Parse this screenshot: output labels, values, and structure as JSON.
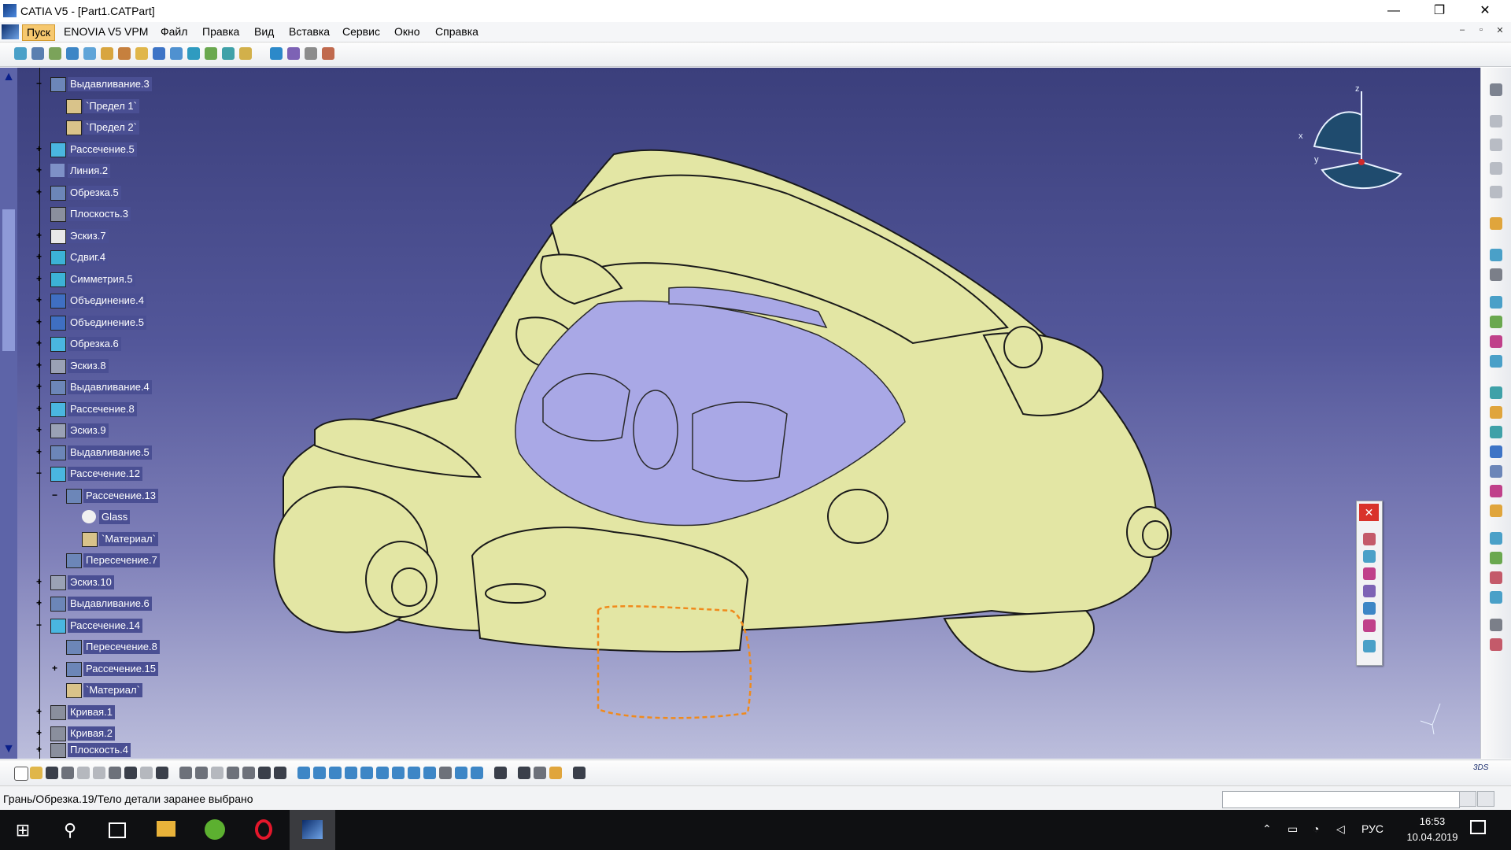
{
  "window": {
    "title": "CATIA V5 - [Part1.CATPart]",
    "minimize": "—",
    "maximize": "❐",
    "close": "✕"
  },
  "menu": {
    "items": [
      "Пуск",
      "ENOVIA V5 VPM",
      "Файл",
      "Правка",
      "Вид",
      "Вставка",
      "Сервис",
      "Окно",
      "Справка"
    ],
    "active_index": 0,
    "mdi_min": "–",
    "mdi_restore": "▫",
    "mdi_close": "✕"
  },
  "tree": {
    "scroll_up": "▲",
    "scroll_down": "▼",
    "nodes": [
      {
        "label": "Выдавливание.3",
        "icon": "pad-icon"
      },
      {
        "label": "`Предел 1`",
        "icon": "limit-icon"
      },
      {
        "label": "`Предел 2`",
        "icon": "limit-icon"
      },
      {
        "label": "Рассечение.5",
        "icon": "split-icon"
      },
      {
        "label": "Линия.2",
        "icon": "line-icon"
      },
      {
        "label": "Обрезка.5",
        "icon": "trim-icon"
      },
      {
        "label": "Плоскость.3",
        "icon": "plane-icon"
      },
      {
        "label": "Эскиз.7",
        "icon": "sketch-icon"
      },
      {
        "label": "Сдвиг.4",
        "icon": "translate-icon"
      },
      {
        "label": "Симметрия.5",
        "icon": "symmetry-icon"
      },
      {
        "label": "Объединение.4",
        "icon": "join-icon"
      },
      {
        "label": "Объединение.5",
        "icon": "join-icon"
      },
      {
        "label": "Обрезка.6",
        "icon": "trim-icon"
      },
      {
        "label": "Эскиз.8",
        "icon": "sketch-icon"
      },
      {
        "label": "Выдавливание.4",
        "icon": "pad-icon"
      },
      {
        "label": "Рассечение.8",
        "icon": "split-icon"
      },
      {
        "label": "Эскиз.9",
        "icon": "sketch-icon"
      },
      {
        "label": "Выдавливание.5",
        "icon": "pad-icon"
      },
      {
        "label": "Рассечение.12",
        "icon": "split-icon"
      },
      {
        "label": "Рассечение.13",
        "icon": "split-icon"
      },
      {
        "label": "Glass",
        "icon": "material-sphere-icon"
      },
      {
        "label": "`Материал`",
        "icon": "material-icon"
      },
      {
        "label": "Пересечение.7",
        "icon": "intersection-icon"
      },
      {
        "label": "Эскиз.10",
        "icon": "sketch-icon"
      },
      {
        "label": "Выдавливание.6",
        "icon": "pad-icon"
      },
      {
        "label": "Рассечение.14",
        "icon": "split-icon"
      },
      {
        "label": "Пересечение.8",
        "icon": "intersection-icon"
      },
      {
        "label": "Рассечение.15",
        "icon": "split-icon"
      },
      {
        "label": "`Материал`",
        "icon": "material-icon"
      },
      {
        "label": "Кривая.1",
        "icon": "curve-icon"
      },
      {
        "label": "Кривая.2",
        "icon": "curve-icon"
      },
      {
        "label": "Плоскость.4",
        "icon": "plane-icon"
      }
    ]
  },
  "compass": {
    "z": "z",
    "x": "x",
    "y": "y"
  },
  "status": {
    "text": "Грань/Обрезка.19/Тело детали заранее выбрано",
    "input_value": ""
  },
  "palette": {
    "close": "✕"
  },
  "taskbar": {
    "lang": "РУС",
    "time": "16:53",
    "date": "10.04.2019",
    "search": "⚲",
    "start": "⊞"
  },
  "colors": {
    "tree_label_bg": "#4a4f93",
    "model_fill": "#e3e6a4",
    "interior_fill": "#a9a8e6",
    "viewport_top": "#3b3f7c",
    "viewport_bottom": "#bcbedc"
  }
}
